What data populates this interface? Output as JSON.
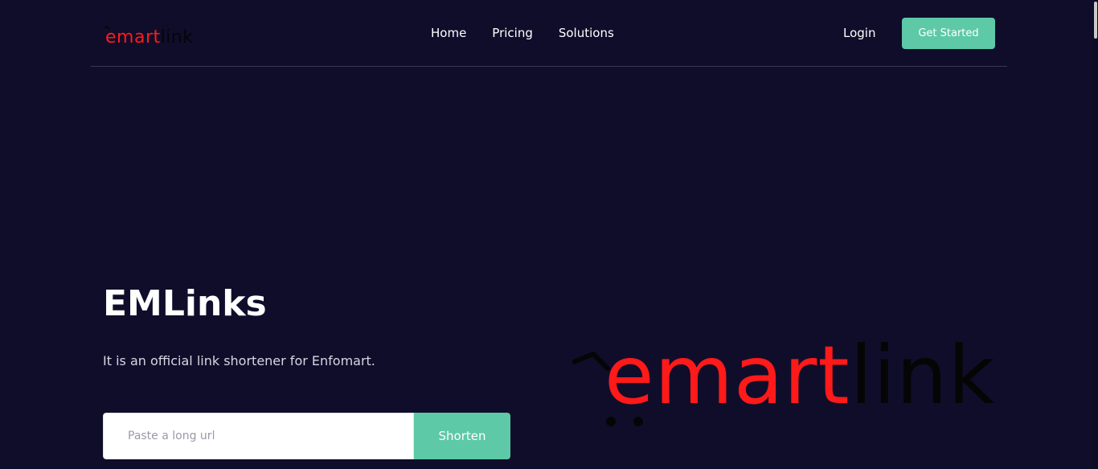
{
  "header": {
    "brand": {
      "part1": "emart",
      "part2": "link"
    },
    "nav": [
      {
        "label": "Home"
      },
      {
        "label": "Pricing"
      },
      {
        "label": "Solutions"
      }
    ],
    "login_label": "Login",
    "cta_label": "Get Started"
  },
  "hero": {
    "title": "EMLinks",
    "subtitle": "It is an official link shortener for Enfomart.",
    "input_placeholder": "Paste a long url",
    "input_value": "",
    "shorten_label": "Shorten",
    "logo": {
      "part1": "emart",
      "part2": "link"
    }
  },
  "colors": {
    "background": "#100d2b",
    "accent": "#5dc9a6",
    "logo_red": "#ff1a1a",
    "logo_dark": "#050505"
  },
  "icons": [
    "cart-icon"
  ]
}
